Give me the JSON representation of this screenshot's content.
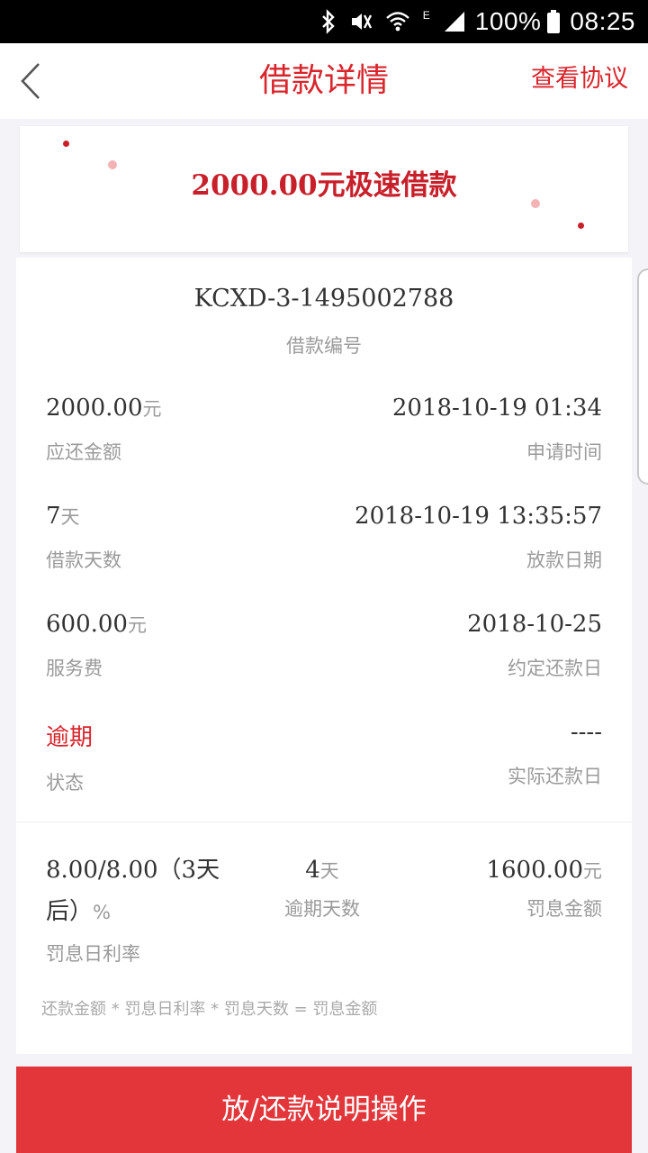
{
  "status_bar": {
    "battery": "100%",
    "time": "08:25",
    "network_label": "E"
  },
  "header": {
    "title": "借款详情",
    "link": "查看协议"
  },
  "banner": {
    "title": "2000.00元极速借款"
  },
  "detail": {
    "loan_no": "KCXD-3-1495002788",
    "loan_no_label": "借款编号",
    "rows": [
      {
        "left_value": "2000.00",
        "left_unit": "元",
        "left_label": "应还金额",
        "right_value": "2018-10-19 01:34",
        "right_label": "申请时间"
      },
      {
        "left_value": "7",
        "left_unit": "天",
        "left_label": "借款天数",
        "right_value": "2018-10-19 13:35:57",
        "right_label": "放款日期"
      },
      {
        "left_value": "600.00",
        "left_unit": "元",
        "left_label": "服务费",
        "right_value": "2018-10-25",
        "right_label": "约定还款日"
      },
      {
        "left_value": "逾期",
        "left_label": "状态",
        "right_value": "----",
        "right_label": "实际还款日"
      }
    ],
    "penalty": {
      "rate_value_line1": "8.00/8.00（3天",
      "rate_value_line2": "后）",
      "rate_unit": "%",
      "rate_label": "罚息日利率",
      "days_value": "4",
      "days_unit": "天",
      "days_label": "逾期天数",
      "amount_value": "1600.00",
      "amount_unit": "元",
      "amount_label": "罚息金额"
    },
    "formula": "还款金额 * 罚息日利率 * 罚息天数 = 罚息金额"
  },
  "action_button": {
    "label": "放/还款说明操作"
  },
  "colors": {
    "accent": "#d9252c",
    "button": "#e2363b",
    "muted": "#9a9a9a"
  }
}
